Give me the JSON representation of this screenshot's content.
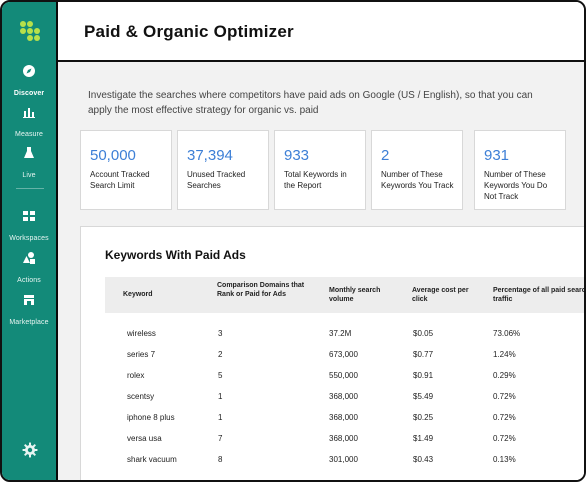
{
  "sidebar": {
    "items": [
      {
        "label": "Discover",
        "icon": "compass-icon"
      },
      {
        "label": "Measure",
        "icon": "bar-chart-icon"
      },
      {
        "label": "Live",
        "icon": "flask-icon"
      },
      {
        "label": "Workspaces",
        "icon": "grid-icon"
      },
      {
        "label": "Actions",
        "icon": "shapes-icon"
      },
      {
        "label": "Marketplace",
        "icon": "store-icon"
      }
    ],
    "settings_icon": "gear-icon"
  },
  "header": {
    "title": "Paid & Organic Optimizer"
  },
  "intro": "Investigate the searches where competitors have paid ads on Google (US / English), so that you can apply the most effective strategy for organic vs. paid",
  "stats": [
    {
      "value": "50,000",
      "label": "Account Tracked Search Limit"
    },
    {
      "value": "37,394",
      "label": "Unused Tracked Searches"
    },
    {
      "value": "933",
      "label": "Total Keywords in the Report"
    },
    {
      "value": "2",
      "label": "Number of These Keywords You Track"
    },
    {
      "value": "931",
      "label": "Number of These Keywords You Do Not Track"
    }
  ],
  "table": {
    "title": "Keywords With Paid Ads",
    "headers": [
      "Keyword",
      "Comparison Domains that Rank or Paid for Ads",
      "Monthly search volume",
      "Average cost per click",
      "Percentage of all paid search traffic"
    ],
    "rows": [
      [
        "wireless",
        "3",
        "37.2M",
        "$0.05",
        "73.06%"
      ],
      [
        "series 7",
        "2",
        "673,000",
        "$0.77",
        "1.24%"
      ],
      [
        "rolex",
        "5",
        "550,000",
        "$0.91",
        "0.29%"
      ],
      [
        "scentsy",
        "1",
        "368,000",
        "$5.49",
        "0.72%"
      ],
      [
        "iphone 8 plus",
        "1",
        "368,000",
        "$0.25",
        "0.72%"
      ],
      [
        "versa usa",
        "7",
        "368,000",
        "$1.49",
        "0.72%"
      ],
      [
        "shark vacuum",
        "8",
        "301,000",
        "$0.43",
        "0.13%"
      ]
    ]
  },
  "colors": {
    "sidebar": "#138a79",
    "accent_number": "#3d7fd6",
    "logo": "#b7e04a"
  }
}
